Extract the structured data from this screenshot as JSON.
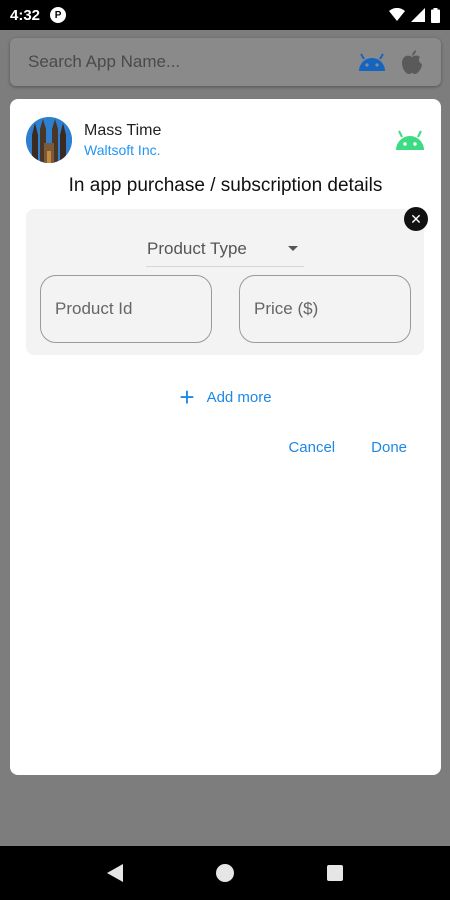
{
  "status_bar": {
    "time": "4:32",
    "notification_glyph": "P"
  },
  "search": {
    "placeholder": "Search App Name..."
  },
  "app": {
    "name": "Mass Time",
    "developer": "Waltsoft Inc."
  },
  "dialog": {
    "title": "In app purchase / subscription details",
    "product_type_label": "Product Type",
    "product_id_placeholder": "Product Id",
    "price_placeholder": "Price ($)",
    "add_more_label": "Add more",
    "cancel_label": "Cancel",
    "done_label": "Done"
  },
  "colors": {
    "accent": "#1e88e5",
    "android_green": "#3ddc84",
    "android_blue": "#1565c0"
  },
  "icons": {
    "status_notification": "notification-icon",
    "wifi": "wifi-icon",
    "signal": "signal-icon",
    "battery": "battery-icon",
    "android_platform": "android-icon",
    "apple_platform": "apple-icon",
    "remove": "close-circle-icon",
    "add": "plus-icon",
    "back": "back-icon",
    "home": "home-icon",
    "recents": "recents-icon"
  }
}
